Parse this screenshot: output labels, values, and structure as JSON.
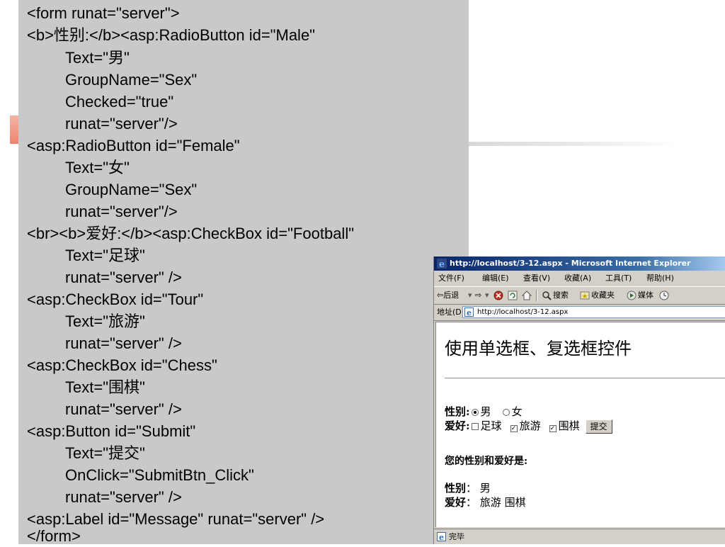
{
  "code": {
    "lines": [
      "<form runat=\"server\">",
      "<b>性别:</b><asp:RadioButton id=\"Male\"",
      "Text=\"男\"",
      "GroupName=\"Sex\"",
      "Checked=\"true\"",
      "runat=\"server\"/>",
      "<asp:RadioButton id=\"Female\"",
      "Text=\"女\"",
      "GroupName=\"Sex\"",
      "runat=\"server\"/>",
      "<br><b>爱好:</b><asp:CheckBox id=\"Football\"",
      "Text=\"足球\"",
      "runat=\"server\" />",
      "<asp:CheckBox id=\"Tour\"",
      "Text=\"旅游\"",
      "runat=\"server\" />",
      "<asp:CheckBox id=\"Chess\"",
      "Text=\"围棋\"",
      "runat=\"server\" />",
      "<asp:Button id=\"Submit\"",
      "Text=\"提交\"",
      "OnClick=\"SubmitBtn_Click\"",
      "runat=\"server\" />",
      "<asp:Label id=\"Message\" runat=\"server\" />",
      "</form>"
    ]
  },
  "browser": {
    "title": "http://localhost/3-12.aspx - Microsoft Internet Explorer",
    "menu": {
      "file": "文件(F)",
      "edit": "编辑(E)",
      "view": "查看(V)",
      "favorites": "收藏(A)",
      "tools": "工具(T)",
      "help": "帮助(H)"
    },
    "toolbar": {
      "back": "⇦后退",
      "forward": "⇨",
      "search": "搜索",
      "favorites": "收藏夹",
      "media": "媒体"
    },
    "address": {
      "label": "地址(D)",
      "url": "http://localhost/3-12.aspx"
    },
    "status": "完毕"
  },
  "page": {
    "heading": "使用单选框、复选框控件",
    "gender_label": "性别:",
    "male_label": "男",
    "female_label": "女",
    "male_checked": true,
    "female_checked": false,
    "hobby_label": "爱好:",
    "football_label": "足球",
    "tour_label": "旅游",
    "chess_label": "围棋",
    "football_checked": false,
    "tour_checked": true,
    "chess_checked": true,
    "submit_label": "提交",
    "result_heading": "您的性别和爱好是:",
    "result_gender_label": "性别",
    "result_gender_value": "男",
    "result_hobby_label": "爱好",
    "result_hobby_value": "旅游 围棋"
  },
  "colors": {
    "code_panel_bg": "#c9c9c9",
    "titlebar_start": "#0a246a",
    "window_chrome": "#d4d0c8",
    "deco_accent": "#ee8470"
  },
  "icons": [
    "ie-logo-icon",
    "back-arrow-icon",
    "forward-arrow-icon",
    "stop-icon",
    "refresh-icon",
    "home-icon",
    "search-icon",
    "favorites-icon",
    "media-icon",
    "page-icon",
    "status-page-icon"
  ]
}
